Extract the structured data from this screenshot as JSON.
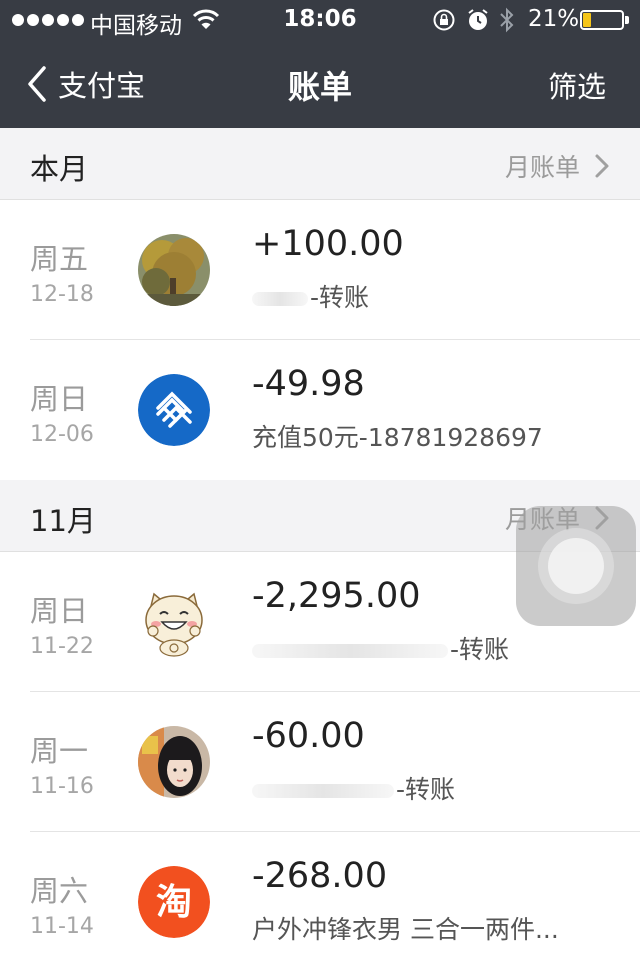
{
  "status_bar": {
    "carrier": "中国移动",
    "time": "18:06",
    "battery_percent": "21%",
    "battery_level": 0.21,
    "battery_fill_color": "#f5c518"
  },
  "nav": {
    "back_label": "支付宝",
    "title": "账单",
    "filter_label": "筛选"
  },
  "sections": [
    {
      "title": "本月",
      "monthly_bill_label": "月账单",
      "transactions": [
        {
          "weekday": "周五",
          "date": "12-18",
          "amount": "+100.00",
          "description": "-转账",
          "avatar": "tree-photo"
        },
        {
          "weekday": "周日",
          "date": "12-06",
          "amount": "-49.98",
          "description": "充值50元-18781928697",
          "avatar": "china-mobile-logo"
        }
      ]
    },
    {
      "title": "11月",
      "monthly_bill_label": "月账单",
      "transactions": [
        {
          "weekday": "周日",
          "date": "11-22",
          "amount": "-2,295.00",
          "description": "-转账",
          "avatar": "cartoon-cat"
        },
        {
          "weekday": "周一",
          "date": "11-16",
          "amount": "-60.00",
          "description": "-转账",
          "avatar": "person-photo"
        },
        {
          "weekday": "周六",
          "date": "11-14",
          "amount": "-268.00",
          "description": "户外冲锋衣男 三合一两件...",
          "avatar": "taobao-logo"
        }
      ]
    }
  ],
  "colors": {
    "header_bg": "#383c44",
    "section_bg": "#f3f3f5",
    "taobao_orange": "#f2501f",
    "china_mobile_blue": "#1569c7"
  }
}
